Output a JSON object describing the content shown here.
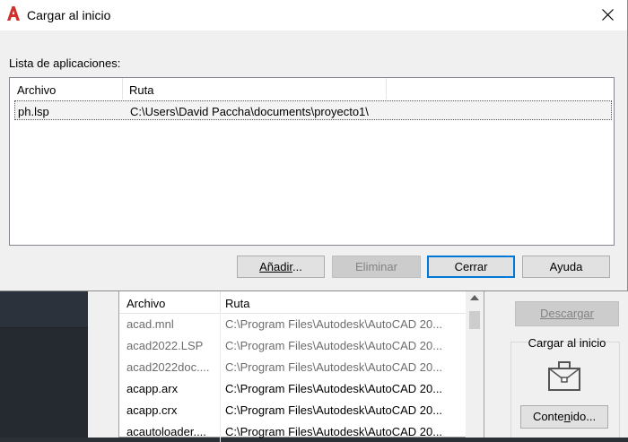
{
  "dialog": {
    "title": "Cargar al inicio",
    "list_label": "Lista de aplicaciones:",
    "columns": [
      "Archivo",
      "Ruta"
    ],
    "rows": [
      {
        "file": "ph.lsp",
        "path": "C:\\Users\\David Paccha\\documents\\proyecto1\\"
      }
    ],
    "buttons": {
      "add": {
        "pre": "Añadir",
        "post": "..."
      },
      "delete": "Eliminar",
      "close": "Cerrar",
      "help": "Ayuda"
    }
  },
  "background": {
    "columns": [
      "Archivo",
      "Ruta"
    ],
    "rows": [
      {
        "file": "acad.mnl",
        "path": "C:\\Program Files\\Autodesk\\AutoCAD 20...",
        "style": "grey"
      },
      {
        "file": "acad2022.LSP",
        "path": "C:\\Program Files\\Autodesk\\AutoCAD 20...",
        "style": "grey"
      },
      {
        "file": "acad2022doc....",
        "path": "C:\\Program Files\\Autodesk\\AutoCAD 20...",
        "style": "grey"
      },
      {
        "file": "acapp.arx",
        "path": "C:\\Program Files\\Autodesk\\AutoCAD 20...",
        "style": "normal"
      },
      {
        "file": "acapp.crx",
        "path": "C:\\Program Files\\Autodesk\\AutoCAD 20...",
        "style": "normal"
      },
      {
        "file": "acautoloader....",
        "path": "C:\\Program Files\\Autodesk\\AutoCAD 20...",
        "style": "normal"
      }
    ],
    "unload_button": "Descargar",
    "startup_group_label": "Cargar al inicio",
    "contents_button": {
      "pre": "Conte",
      "mnemonic": "n",
      "post": "ido..."
    }
  },
  "icons": {
    "app_logo": "autocad-logo-icon",
    "close": "close-icon",
    "briefcase": "briefcase-icon",
    "scroll_up": "scroll-up-arrow-icon"
  },
  "colors": {
    "accent": "#0078d7",
    "logo": "#d0312d"
  }
}
